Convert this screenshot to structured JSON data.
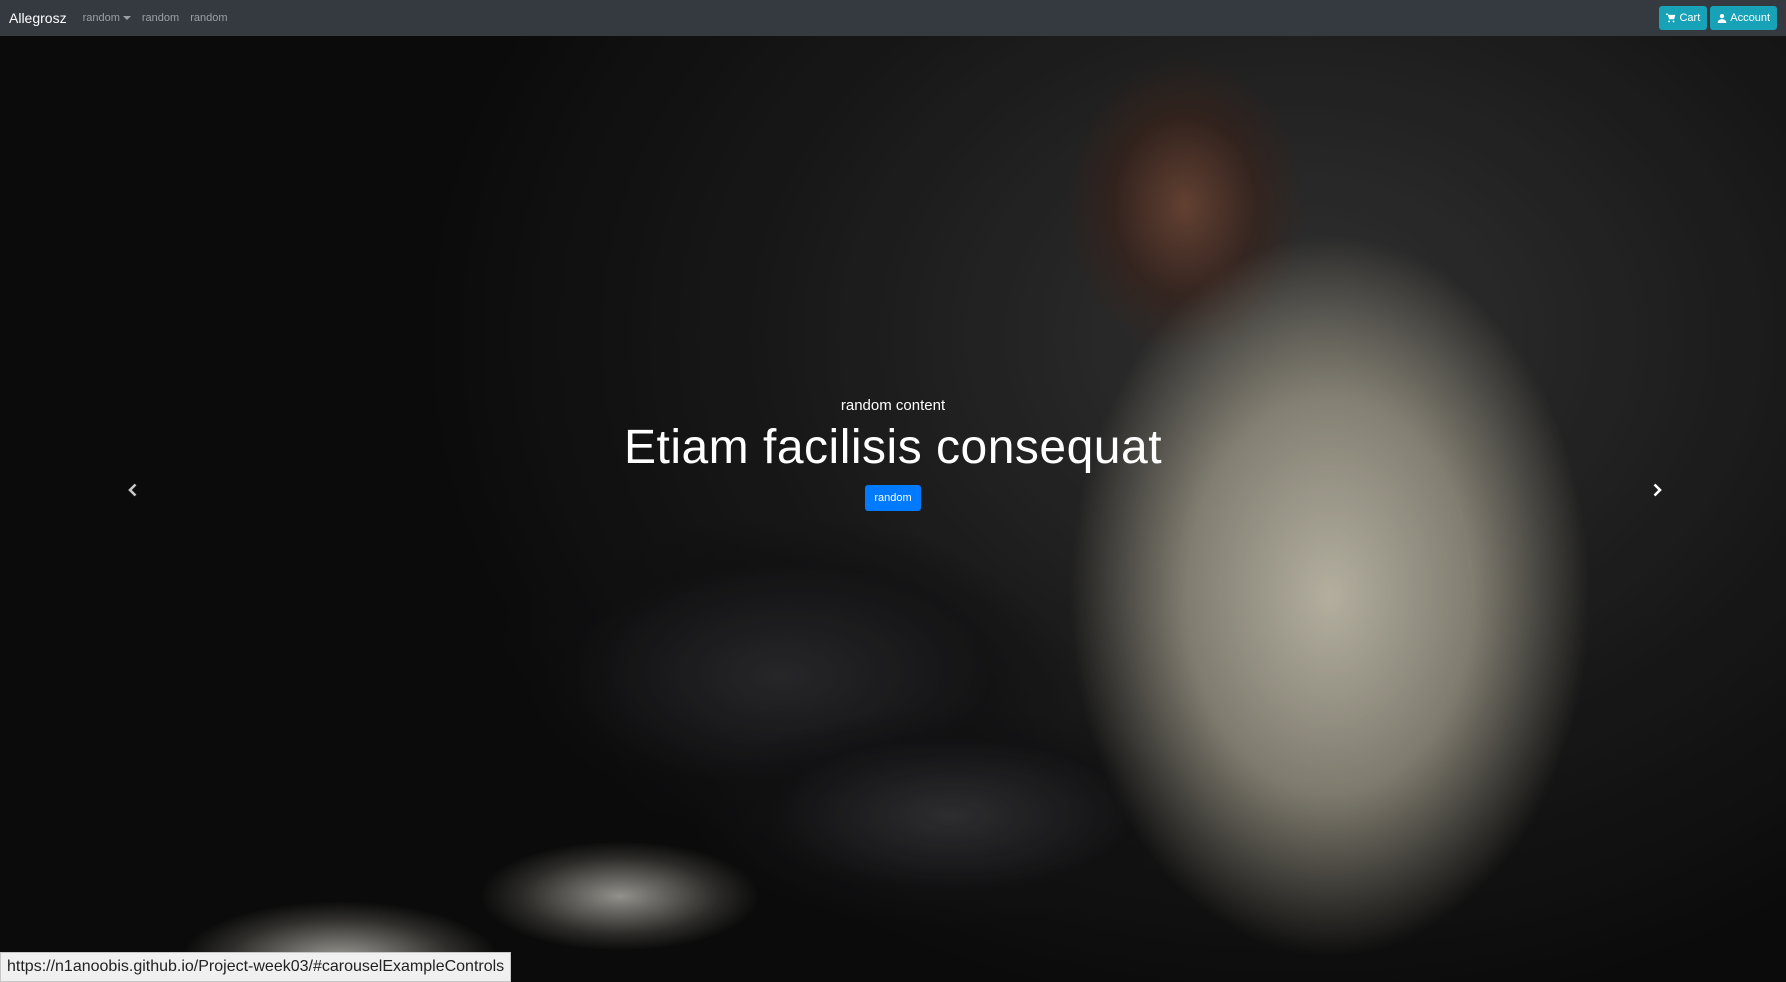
{
  "navbar": {
    "brand": "Allegrosz",
    "links": [
      {
        "label": "random",
        "has_dropdown": true
      },
      {
        "label": "random",
        "has_dropdown": false
      },
      {
        "label": "random",
        "has_dropdown": false
      }
    ],
    "cart_label": "Cart",
    "cart_icon": "cart-icon",
    "account_label": "Account",
    "account_icon": "user-icon",
    "background": "#343a40",
    "button_color": "#17a2b8"
  },
  "carousel": {
    "caption_sub": "random content",
    "caption_title": "Etiam facilisis consequat",
    "caption_button": "random",
    "prev_icon": "chevron-left-icon",
    "next_icon": "chevron-right-icon",
    "button_color": "#007bff"
  },
  "status_bar": {
    "url": "https://n1anoobis.github.io/Project-week03/#carouselExampleControls"
  }
}
